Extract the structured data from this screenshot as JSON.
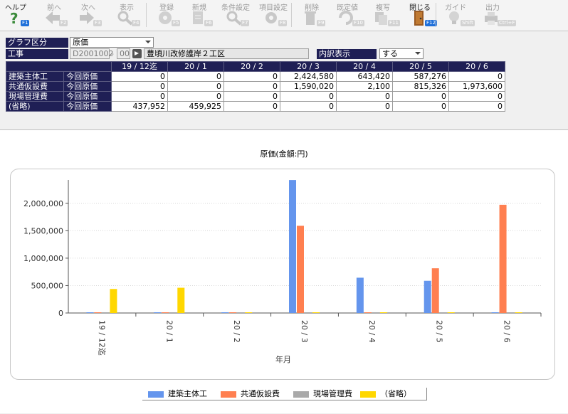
{
  "toolbar": {
    "buttons": [
      {
        "label": "ヘルプ",
        "key": "F1",
        "enabled": true,
        "icon": "help-icon"
      },
      {
        "label": "前へ",
        "key": "F2",
        "enabled": false,
        "icon": "arrow-left-icon"
      },
      {
        "label": "次へ",
        "key": "F3",
        "enabled": false,
        "icon": "arrow-right-icon"
      },
      {
        "label": "表示",
        "key": "F4",
        "enabled": false,
        "icon": "magnifier-icon"
      },
      {
        "label": "登録",
        "key": "F5",
        "enabled": false,
        "icon": "disk-icon"
      },
      {
        "label": "新規",
        "key": "F6",
        "enabled": false,
        "icon": "new-document-icon"
      },
      {
        "label": "条件設定",
        "key": "F7",
        "enabled": false,
        "icon": "search-settings-icon"
      },
      {
        "label": "項目設定",
        "key": "F8",
        "enabled": false,
        "icon": "item-settings-icon"
      },
      {
        "label": "削除",
        "key": "F9",
        "enabled": false,
        "icon": "trash-icon"
      },
      {
        "label": "既定値",
        "key": "F10",
        "enabled": false,
        "icon": "refresh-icon"
      },
      {
        "label": "複写",
        "key": "F11",
        "enabled": false,
        "icon": "copy-icon"
      },
      {
        "label": "閉じる",
        "key": "F12",
        "enabled": true,
        "icon": "door-icon"
      },
      {
        "label": "ガイド",
        "key": "Shift",
        "enabled": false,
        "icon": "lightbulb-icon"
      },
      {
        "label": "出力",
        "key": "Ctrl+F",
        "enabled": false,
        "icon": "printer-icon"
      }
    ]
  },
  "filters": {
    "graph_label": "グラフ区分",
    "graph_value": "原価",
    "project_label": "工事",
    "project_code": "D2001002",
    "project_sep": "-",
    "project_sub": "00",
    "project_name": "豊頃川改修護岸２工区",
    "detail_label": "内訳表示",
    "detail_value": "する"
  },
  "table": {
    "columns": [
      "19 / 12迄",
      "20 / 1",
      "20 / 2",
      "20 / 3",
      "20 / 4",
      "20 / 5",
      "20 / 6"
    ],
    "rows": [
      {
        "name": "建築主体工",
        "sub": "今回原価",
        "values": [
          "0",
          "0",
          "0",
          "2,424,580",
          "643,420",
          "587,276",
          "0"
        ]
      },
      {
        "name": "共通仮設費",
        "sub": "今回原価",
        "values": [
          "0",
          "0",
          "0",
          "1,590,020",
          "2,100",
          "815,326",
          "1,973,600"
        ]
      },
      {
        "name": "現場管理費",
        "sub": "今回原価",
        "values": [
          "0",
          "0",
          "0",
          "0",
          "0",
          "0",
          "0"
        ]
      },
      {
        "name": "(省略)",
        "sub": "今回原価",
        "values": [
          "437,952",
          "459,925",
          "0",
          "0",
          "0",
          "0",
          "0"
        ]
      }
    ]
  },
  "chart_data": {
    "type": "bar",
    "title": "原価(金額:円)",
    "xlabel": "年月",
    "ylabel": "",
    "categories": [
      "19 / 12迄",
      "20 / 1",
      "20 / 2",
      "20 / 3",
      "20 / 4",
      "20 / 5",
      "20 / 6"
    ],
    "yticks": [
      "0",
      "500,000",
      "1,000,000",
      "1,500,000",
      "2,000,000"
    ],
    "ylim": [
      0,
      2400000
    ],
    "grid": true,
    "legend_position": "bottom",
    "series": [
      {
        "name": "建築主体工",
        "color": "#6495ed",
        "values": [
          0,
          0,
          0,
          2424580,
          643420,
          587276,
          0
        ]
      },
      {
        "name": "共通仮設費",
        "color": "#ff7f50",
        "values": [
          0,
          0,
          0,
          1590020,
          2100,
          815326,
          1973600
        ]
      },
      {
        "name": "現場管理費",
        "color": "#a9a9a9",
        "values": [
          0,
          0,
          0,
          0,
          0,
          0,
          0
        ]
      },
      {
        "name": "（省略）",
        "color": "#ffd700",
        "values": [
          437952,
          459925,
          0,
          0,
          0,
          0,
          0
        ]
      }
    ]
  }
}
